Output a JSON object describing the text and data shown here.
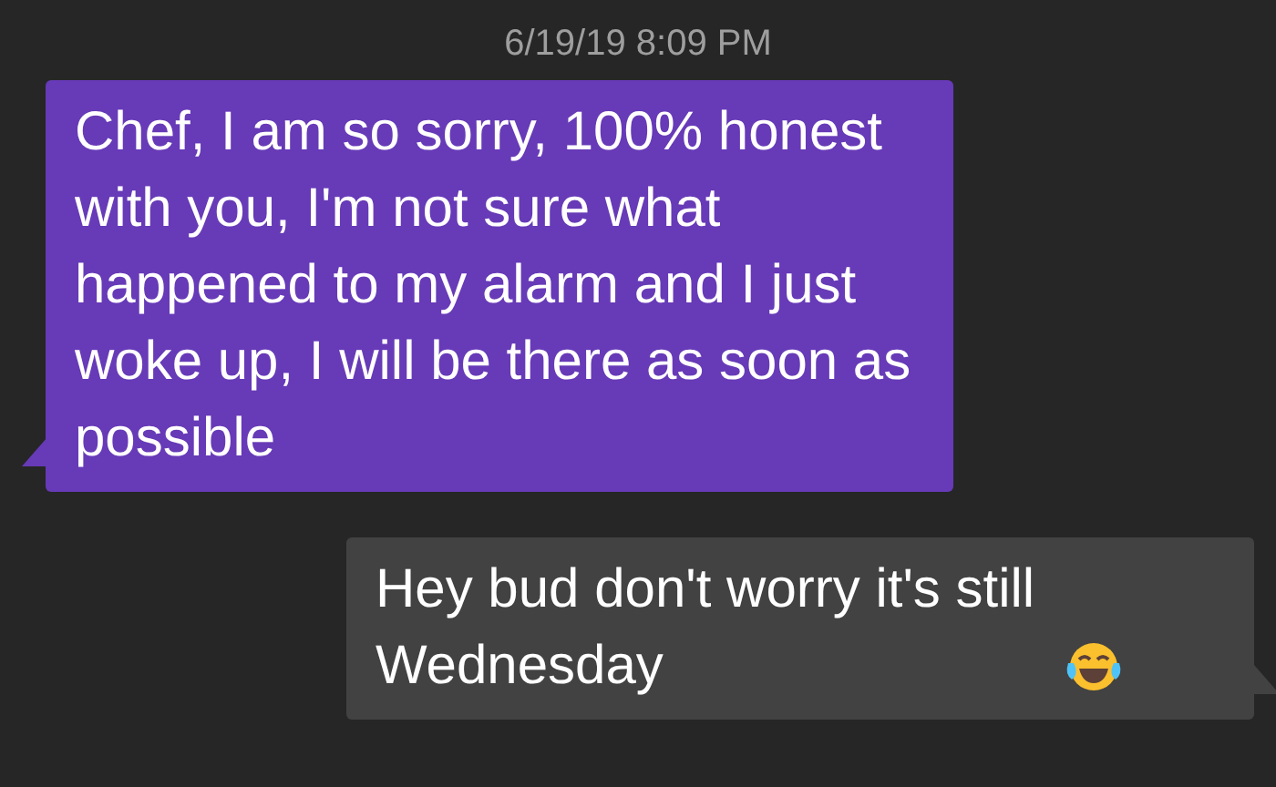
{
  "timestamp": "6/19/19 8:09 PM",
  "messages": [
    {
      "kind": "incoming",
      "text": "Chef, I am so sorry, 100% honest with you, I'm not sure what happened to my alarm and I just woke up, I will be there as soon as possible",
      "has_emoji": false
    },
    {
      "kind": "outgoing",
      "text": "Hey bud don't worry it's still Wednesday",
      "has_emoji": true
    }
  ]
}
